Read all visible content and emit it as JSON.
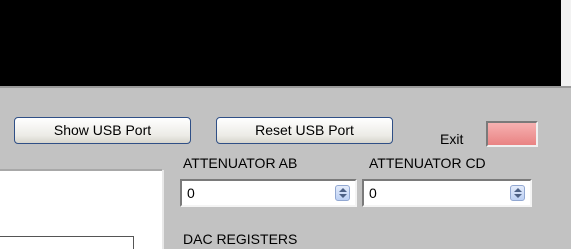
{
  "toolbar": {
    "show_usb_port_label": "Show USB Port",
    "reset_usb_port_label": "Reset USB Port",
    "exit_label": "Exit",
    "exit_indicator_color": "#ef9a9a"
  },
  "attenuators": {
    "ab": {
      "label": "ATTENUATOR AB",
      "value": "0"
    },
    "cd": {
      "label": "ATTENUATOR CD",
      "value": "0"
    }
  },
  "dac": {
    "label": "DAC REGISTERS"
  },
  "colors": {
    "background": "#c2c2c2",
    "display_panel": "#000000",
    "button_border": "#2f4f86"
  }
}
